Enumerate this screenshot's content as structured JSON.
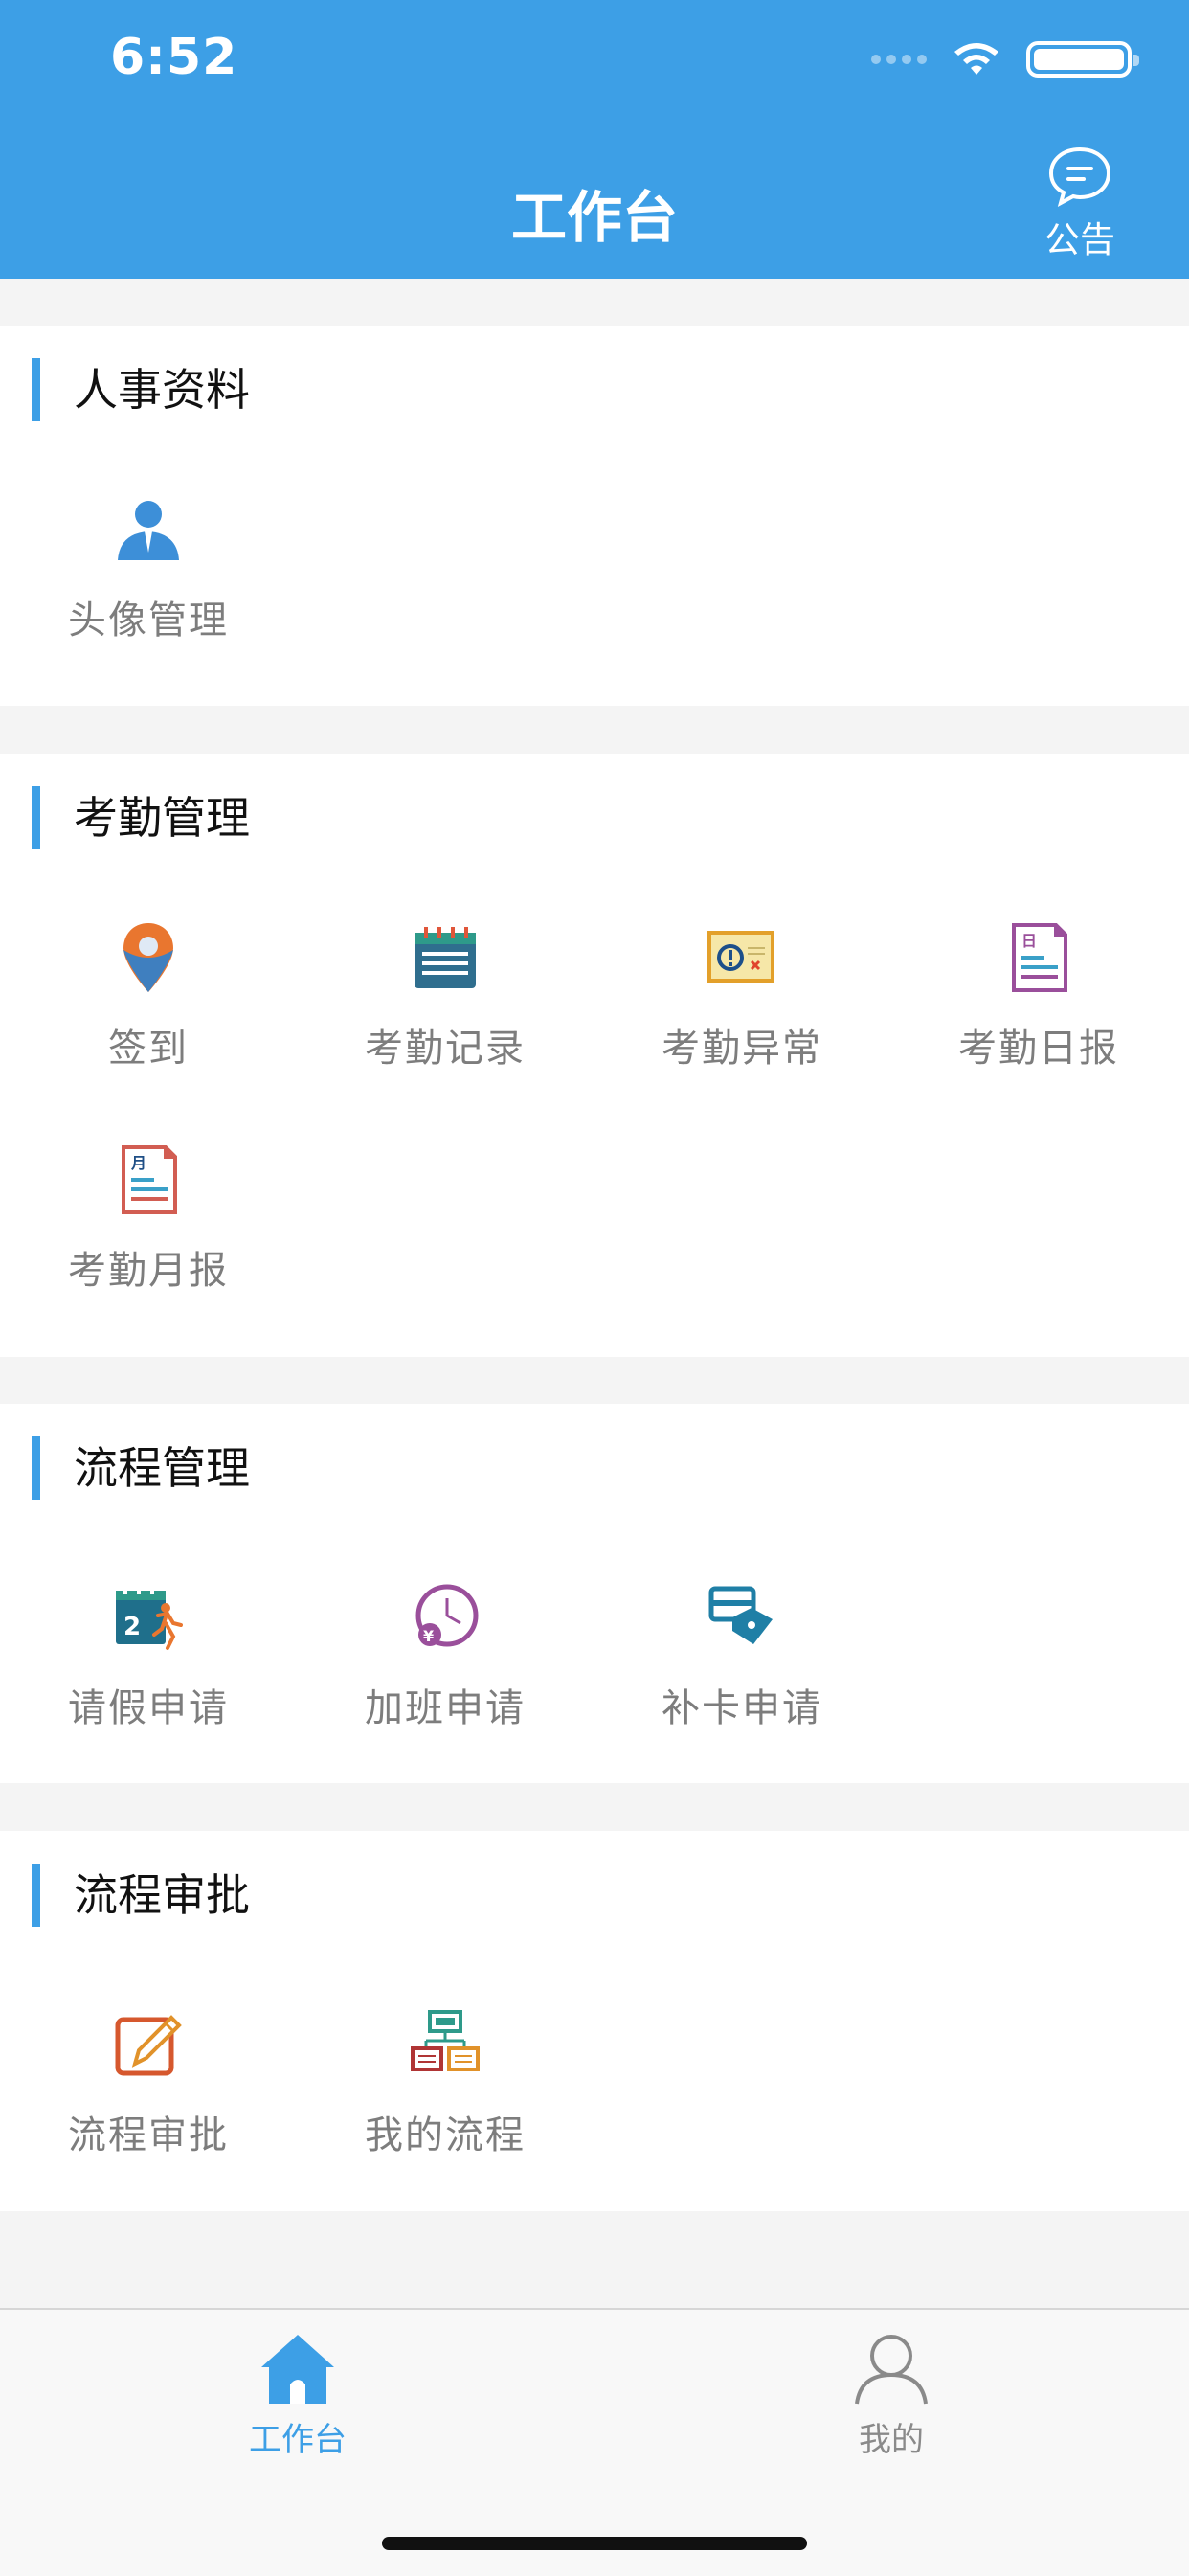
{
  "status_bar": {
    "time": "6:52"
  },
  "header": {
    "title": "工作台",
    "notice_label": "公告"
  },
  "sections": [
    {
      "title": "人事资料",
      "items": [
        {
          "label": "头像管理",
          "icon": "avatar-icon"
        }
      ]
    },
    {
      "title": "考勤管理",
      "items": [
        {
          "label": "签到",
          "icon": "location-pin-icon"
        },
        {
          "label": "考勤记录",
          "icon": "calendar-icon"
        },
        {
          "label": "考勤异常",
          "icon": "warning-card-icon"
        },
        {
          "label": "考勤日报",
          "icon": "daily-report-icon"
        },
        {
          "label": "考勤月报",
          "icon": "monthly-report-icon"
        }
      ]
    },
    {
      "title": "流程管理",
      "items": [
        {
          "label": "请假申请",
          "icon": "calendar-run-icon"
        },
        {
          "label": "加班申请",
          "icon": "clock-money-icon"
        },
        {
          "label": "补卡申请",
          "icon": "card-tag-icon"
        }
      ]
    },
    {
      "title": "流程审批",
      "items": [
        {
          "label": "流程审批",
          "icon": "edit-icon"
        },
        {
          "label": "我的流程",
          "icon": "flowchart-icon"
        }
      ]
    }
  ],
  "tabbar": {
    "tabs": [
      {
        "label": "工作台",
        "icon": "home-icon",
        "active": true
      },
      {
        "label": "我的",
        "icon": "person-icon",
        "active": false
      }
    ]
  },
  "colors": {
    "brand": "#3d9fe6",
    "active_tab": "#3d9fe6",
    "inactive_tab": "#8a8a8a"
  }
}
